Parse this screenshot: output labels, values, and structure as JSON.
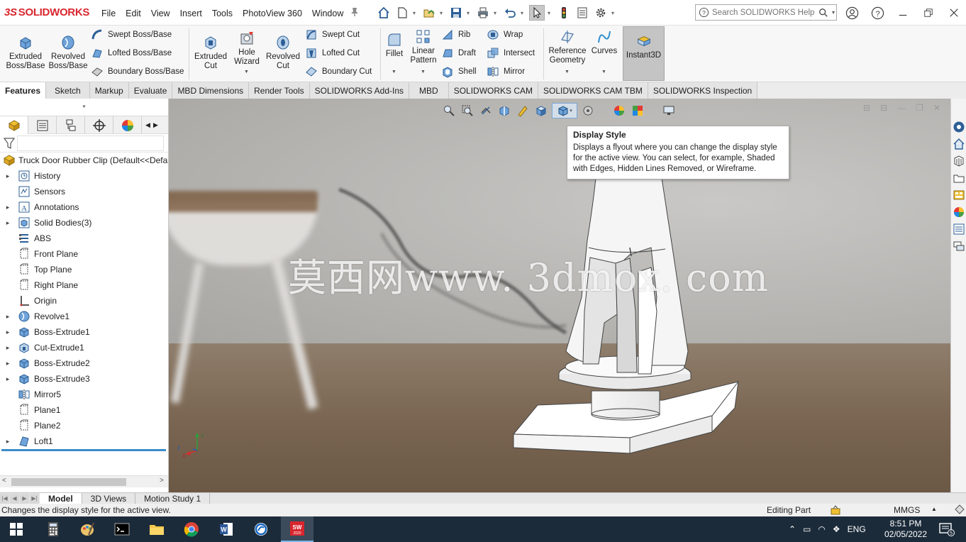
{
  "app": {
    "logo_text": "SOLIDWORKS",
    "logo_prefix": "3S"
  },
  "menu": [
    "File",
    "Edit",
    "View",
    "Insert",
    "Tools",
    "PhotoView 360",
    "Window"
  ],
  "search": {
    "placeholder": "Search SOLIDWORKS Help"
  },
  "ribbon": {
    "extruded_boss": "Extruded Boss/Base",
    "revolved_boss": "Revolved Boss/Base",
    "swept_boss": "Swept Boss/Base",
    "lofted_boss": "Lofted Boss/Base",
    "boundary_boss": "Boundary Boss/Base",
    "extruded_cut": "Extruded Cut",
    "hole_wizard": "Hole Wizard",
    "revolved_cut": "Revolved Cut",
    "swept_cut": "Swept Cut",
    "lofted_cut": "Lofted Cut",
    "boundary_cut": "Boundary Cut",
    "fillet": "Fillet",
    "linear_pattern": "Linear Pattern",
    "rib": "Rib",
    "draft": "Draft",
    "shell": "Shell",
    "wrap": "Wrap",
    "intersect": "Intersect",
    "mirror": "Mirror",
    "reference_geometry": "Reference Geometry",
    "curves": "Curves",
    "instant3d": "Instant3D"
  },
  "cm_tabs": [
    "Features",
    "Sketch",
    "Markup",
    "Evaluate",
    "MBD Dimensions",
    "Render Tools",
    "SOLIDWORKS Add-Ins",
    "MBD",
    "SOLIDWORKS CAM",
    "SOLIDWORKS CAM TBM",
    "SOLIDWORKS Inspection"
  ],
  "feature_tree": {
    "root": "Truck Door Rubber Clip  (Default<<Defa",
    "items": [
      {
        "label": "History",
        "expandable": true,
        "icon": "history-icon"
      },
      {
        "label": "Sensors",
        "expandable": false,
        "icon": "sensors-icon"
      },
      {
        "label": "Annotations",
        "expandable": true,
        "icon": "annotations-icon"
      },
      {
        "label": "Solid Bodies(3)",
        "expandable": true,
        "icon": "solid-bodies-icon"
      },
      {
        "label": "ABS",
        "expandable": false,
        "icon": "material-icon"
      },
      {
        "label": "Front Plane",
        "expandable": false,
        "icon": "plane-icon"
      },
      {
        "label": "Top Plane",
        "expandable": false,
        "icon": "plane-icon"
      },
      {
        "label": "Right Plane",
        "expandable": false,
        "icon": "plane-icon"
      },
      {
        "label": "Origin",
        "expandable": false,
        "icon": "origin-icon"
      },
      {
        "label": "Revolve1",
        "expandable": true,
        "icon": "revolve-icon"
      },
      {
        "label": "Boss-Extrude1",
        "expandable": true,
        "icon": "extrude-icon"
      },
      {
        "label": "Cut-Extrude1",
        "expandable": true,
        "icon": "cut-extrude-icon"
      },
      {
        "label": "Boss-Extrude2",
        "expandable": true,
        "icon": "extrude-icon"
      },
      {
        "label": "Boss-Extrude3",
        "expandable": true,
        "icon": "extrude-icon"
      },
      {
        "label": "Mirror5",
        "expandable": false,
        "icon": "mirror-icon"
      },
      {
        "label": "Plane1",
        "expandable": false,
        "icon": "plane-icon"
      },
      {
        "label": "Plane2",
        "expandable": false,
        "icon": "plane-icon"
      },
      {
        "label": "Loft1",
        "expandable": true,
        "icon": "loft-icon"
      }
    ]
  },
  "tooltip": {
    "title": "Display Style",
    "body": "Displays a flyout where you can change the display style for the active view. You can select, for example, Shaded with Edges, Hidden Lines Removed, or Wireframe."
  },
  "watermark": "莫西网www. 3dmox. com",
  "triad": {
    "x": "X",
    "y": "Y",
    "z": "Z"
  },
  "bottom_tabs": [
    "Model",
    "3D Views",
    "Motion Study 1"
  ],
  "status": {
    "message": "Changes the display style for the active view.",
    "mode": "Editing Part",
    "units": "MMGS"
  },
  "taskbar": {
    "lang": "ENG",
    "time": "8:51 PM",
    "date": "02/05/2022",
    "notifications": "5",
    "sw_badge": "2020"
  },
  "colors": {
    "brand_red": "#d8262e",
    "accent_blue": "#3b6fa8",
    "taskbar": "#1c2b3a"
  }
}
